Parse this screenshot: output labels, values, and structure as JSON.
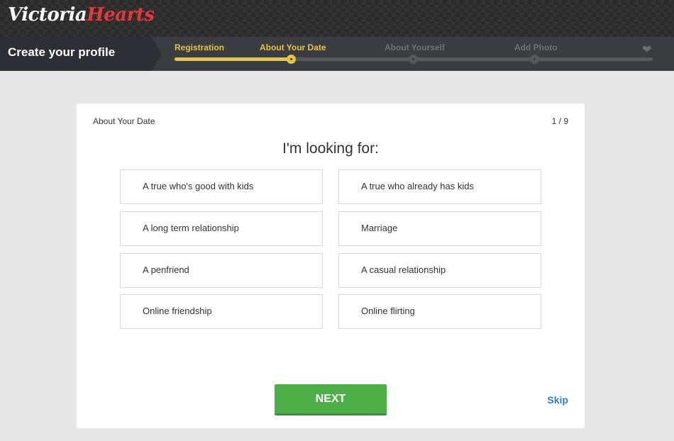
{
  "logo": {
    "part1": "Victoria",
    "part2": "Hearts"
  },
  "profile_bar": {
    "title": "Create your profile"
  },
  "steps": [
    {
      "label": "Registration",
      "state": "done"
    },
    {
      "label": "About Your Date",
      "state": "current"
    },
    {
      "label": "About Yourself",
      "state": "todo"
    },
    {
      "label": "Add Photo",
      "state": "todo"
    }
  ],
  "card": {
    "section": "About Your Date",
    "counter": "1 / 9",
    "question": "I'm looking for:",
    "options": [
      "A true who's good with kids",
      "A true who already has kids",
      "A long term relationship",
      "Marriage",
      "A penfriend",
      "A casual relationship",
      "Online friendship",
      "Online flirting"
    ],
    "next_label": "NEXT",
    "skip_label": "Skip"
  },
  "colors": {
    "accent_yellow": "#e9c43a",
    "button_green": "#4caf48",
    "link_blue": "#2f7fc4",
    "logo_red": "#e03a3a"
  },
  "icons": {
    "heart": "heart-icon"
  }
}
